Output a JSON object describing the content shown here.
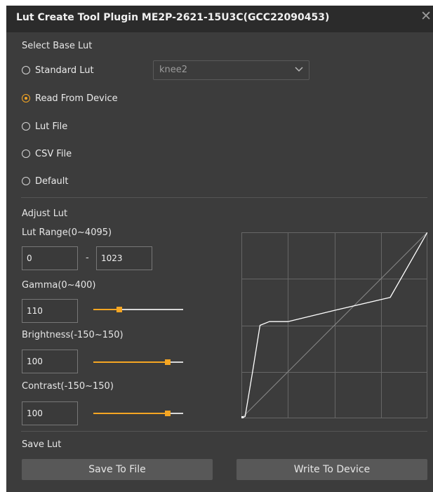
{
  "window": {
    "title": "Lut Create Tool Plugin  ME2P-2621-15U3C(GCC22090453)",
    "close_glyph": "✕"
  },
  "select_base": {
    "heading": "Select Base Lut",
    "options": [
      {
        "label": "Standard Lut",
        "checked": false
      },
      {
        "label": "Read From Device",
        "checked": true
      },
      {
        "label": "Lut File",
        "checked": false
      },
      {
        "label": "CSV File",
        "checked": false
      },
      {
        "label": "Default",
        "checked": false
      }
    ],
    "standard_lut_select": {
      "value": "knee2",
      "icon": "chevron-down-icon"
    }
  },
  "adjust": {
    "heading": "Adjust Lut",
    "lut_range": {
      "label": "Lut Range(0~4095)",
      "min": "0",
      "separator": "-",
      "max": "1023"
    },
    "gamma": {
      "label": "Gamma(0~400)",
      "value": "110",
      "slider_fraction": 0.29
    },
    "brightness": {
      "label": "Brightness(-150~150)",
      "value": "100",
      "slider_fraction": 0.83
    },
    "contrast": {
      "label": "Contrast(-150~150)",
      "value": "100",
      "slider_fraction": 0.83
    }
  },
  "save": {
    "heading": "Save Lut",
    "save_to_file": "Save To File",
    "write_to_device": "Write To Device"
  },
  "colors": {
    "accent": "#f5a623",
    "panel": "#3c3c3c",
    "titlebar": "#2b2b2b",
    "button": "#585858"
  },
  "chart_data": {
    "type": "line",
    "grid": true,
    "xlim": [
      0,
      1
    ],
    "ylim": [
      0,
      1
    ],
    "series": [
      {
        "values_xy": [
          [
            0,
            0
          ],
          [
            1,
            1
          ]
        ]
      },
      {
        "values_xy": [
          [
            0,
            0
          ],
          [
            0.02,
            0.01
          ],
          [
            0.06,
            0.25
          ],
          [
            0.1,
            0.5
          ],
          [
            0.15,
            0.52
          ],
          [
            0.25,
            0.52
          ],
          [
            0.5,
            0.58
          ],
          [
            0.8,
            0.65
          ],
          [
            1,
            1
          ]
        ]
      }
    ]
  }
}
